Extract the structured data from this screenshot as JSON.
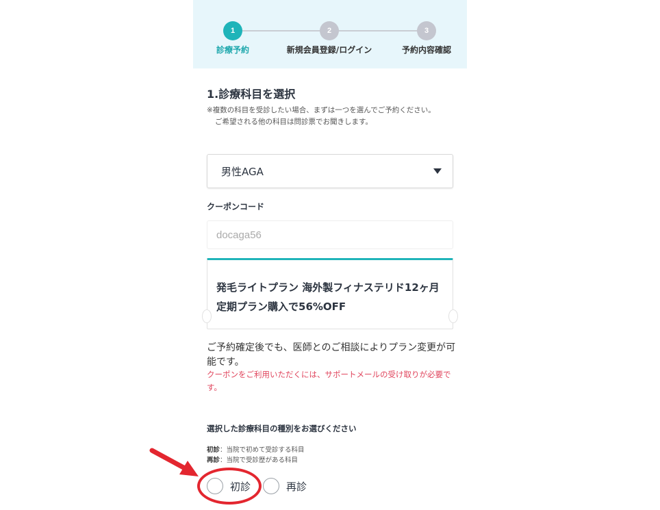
{
  "stepper": {
    "steps": [
      {
        "number": "1",
        "label": "診療予約"
      },
      {
        "number": "2",
        "label": "新規会員登録/ログイン"
      },
      {
        "number": "3",
        "label": "予約内容確認"
      }
    ]
  },
  "section": {
    "title": "1.診療科目を選択",
    "note_line1": "※複数の科目を受診したい場合、まずは一つを選んでご予約ください。",
    "note_line2": "ご希望される他の科目は問診票でお聞きします。"
  },
  "department_select": {
    "value": "男性AGA"
  },
  "coupon": {
    "label": "クーポンコード",
    "value": "docaga56",
    "ticket_text": "発毛ライトプラン 海外製フィナステリド12ヶ月定期プラン購入で56%OFF"
  },
  "plan_note": "ご予約確定後でも、医師とのご相談によりプラン変更が可能です。",
  "coupon_warning": "クーポンをご利用いただくには、サポートメールの受け取りが必要です。",
  "visit_type": {
    "title": "選択した診療科目の種別をお選びください",
    "first_term": "初診",
    "first_desc": "：当院で初めて受診する科目",
    "repeat_term": "再診",
    "repeat_desc": "：当院で受診歴がある科目",
    "options": [
      "初診",
      "再診"
    ]
  },
  "colors": {
    "accent": "#1fb4b9",
    "stepper_bg": "#e7f6fb",
    "warning": "#e0455d",
    "annotation": "#e3262f"
  }
}
